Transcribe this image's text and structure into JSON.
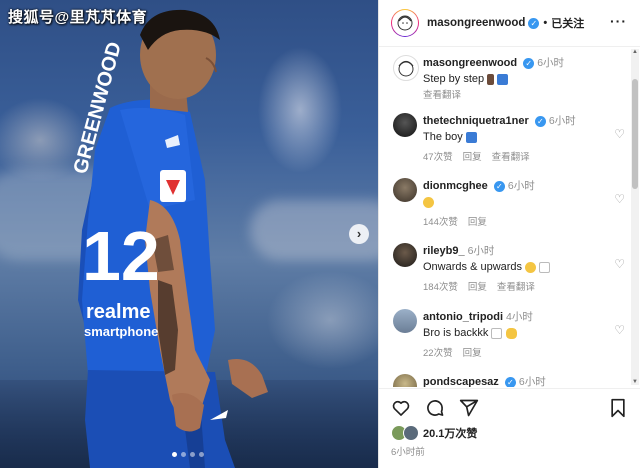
{
  "watermark": "搜狐号@里芃芃体育",
  "photo": {
    "jersey_name": "GREENWOOD",
    "jersey_number": "12",
    "sponsor_line1": "realme",
    "sponsor_line2": "smartphone",
    "league_badge": "LALIGA",
    "carousel_pages": 4,
    "carousel_active": 0
  },
  "header": {
    "username": "masongreenwood",
    "separator": "•",
    "follow_status": "已关注",
    "more_icon": "more-horizontal-icon"
  },
  "comments": [
    {
      "username": "masongreenwood",
      "verified": true,
      "time": "6小时",
      "text": "Step by step",
      "emojis": [
        "pray-emoji",
        "blue-square-emoji"
      ],
      "meta": [
        "查看翻译"
      ],
      "has_heart": false
    },
    {
      "username": "thetechniquetra1ner",
      "verified": true,
      "time": "6小时",
      "text": "The boy",
      "emojis": [
        "down-arrow-blue-emoji"
      ],
      "meta": [
        "47次赞",
        "回复",
        "查看翻译"
      ],
      "has_heart": true
    },
    {
      "username": "dionmcghee",
      "verified": true,
      "time": "6小时",
      "text": "",
      "emojis": [
        "relieved-face-emoji"
      ],
      "meta": [
        "144次赞",
        "回复"
      ],
      "has_heart": true
    },
    {
      "username": "rileyb9_",
      "verified": false,
      "time": "6小时",
      "text": "Onwards & upwards",
      "emojis": [
        "sparkle-emoji",
        "chart-up-emoji"
      ],
      "meta": [
        "184次赞",
        "回复",
        "查看翻译"
      ],
      "has_heart": true
    },
    {
      "username": "antonio_tripodi",
      "verified": false,
      "time": "4小时",
      "text": "Bro is backkk",
      "emojis": [
        "chart-up-emoji",
        "handshake-emoji"
      ],
      "meta": [
        "22次赞",
        "回复"
      ],
      "has_heart": true
    },
    {
      "username": "pondscapesaz",
      "verified": true,
      "time": "6小时",
      "text": "",
      "emojis": [],
      "meta": [],
      "has_heart": false
    }
  ],
  "actions": {
    "like_icon": "heart-icon",
    "comment_icon": "comment-icon",
    "share_icon": "send-icon",
    "save_icon": "bookmark-icon"
  },
  "likes_count": "20.1万次赞",
  "posted_time": "6小时前",
  "colors": {
    "jersey": "#1f5fd4",
    "verified": "#3897f0",
    "text": "#222222",
    "muted": "#8e8e8e"
  }
}
